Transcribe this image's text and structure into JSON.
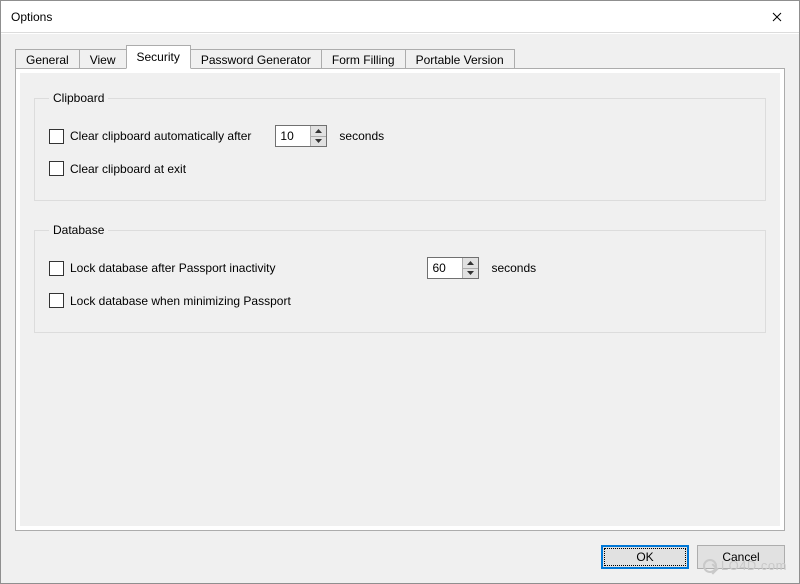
{
  "window": {
    "title": "Options"
  },
  "tabs": {
    "general": "General",
    "view": "View",
    "security": "Security",
    "password_generator": "Password Generator",
    "form_filling": "Form Filling",
    "portable_version": "Portable Version"
  },
  "groups": {
    "clipboard": {
      "legend": "Clipboard",
      "clear_after_label": "Clear clipboard automatically after",
      "clear_after_value": "10",
      "clear_after_suffix": "seconds",
      "clear_exit_label": "Clear clipboard at exit"
    },
    "database": {
      "legend": "Database",
      "lock_inactivity_label": "Lock database after Passport inactivity",
      "lock_inactivity_value": "60",
      "lock_inactivity_suffix": "seconds",
      "lock_minimize_label": "Lock database when minimizing Passport"
    }
  },
  "buttons": {
    "ok": "OK",
    "cancel": "Cancel"
  },
  "watermark": "LO4D.com"
}
